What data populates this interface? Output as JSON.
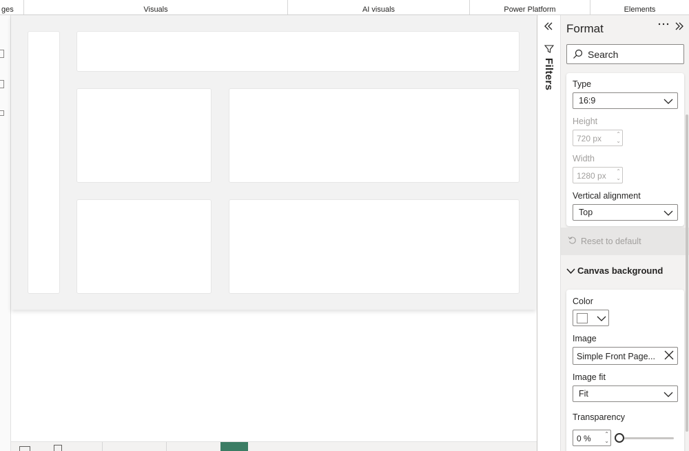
{
  "ribbon": {
    "groups": [
      "ges",
      "Visuals",
      "AI visuals",
      "Power Platform",
      "Elements"
    ]
  },
  "filters": {
    "label": "Filters",
    "collapse_icon": "double-chevron-left-icon",
    "funnel_icon": "funnel-icon"
  },
  "format": {
    "title": "Format",
    "more_icon": "ellipsis-icon",
    "expand_icon": "double-chevron-right-icon",
    "search_placeholder": "Search",
    "canvas_settings": {
      "type_label": "Type",
      "type_value": "16:9",
      "height_label": "Height",
      "height_value": "720 px",
      "width_label": "Width",
      "width_value": "1280 px",
      "valign_label": "Vertical alignment",
      "valign_value": "Top"
    },
    "reset_label": "Reset to default",
    "canvas_background": {
      "section_label": "Canvas background",
      "color_label": "Color",
      "color_value": "#ffffff",
      "image_label": "Image",
      "image_value": "Simple Front Page...",
      "image_fit_label": "Image fit",
      "image_fit_value": "Fit",
      "transparency_label": "Transparency",
      "transparency_value": "0 %",
      "transparency_level": 0
    }
  },
  "colors": {
    "active_tab": "#3b7d64",
    "page_bg": "#f2f2f2",
    "pane_bg": "#f3f2f1"
  }
}
